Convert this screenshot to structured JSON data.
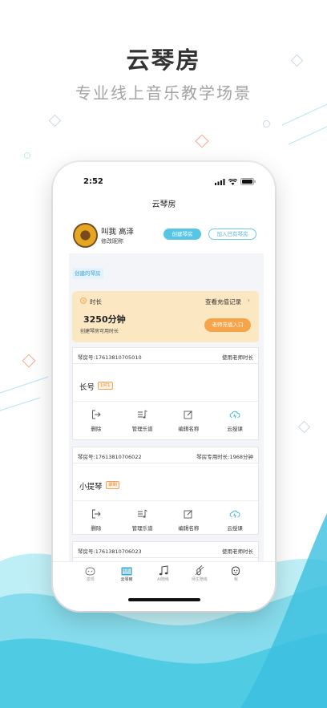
{
  "hero": {
    "title": "云琴房",
    "subtitle": "专业线上音乐教学场景"
  },
  "status_bar": {
    "time": "2:52"
  },
  "nav": {
    "title": "云琴房"
  },
  "profile": {
    "nickname": "叫我 高泽",
    "edit_label": "修改昵称",
    "create_button": "创建琴房",
    "join_button": "加入已有琴房"
  },
  "section_tag": "创建的琴房",
  "time_card": {
    "label": "时长",
    "records_link": "查看充值记录",
    "value": "3250分钟",
    "desc": "创建琴房可用时长",
    "recharge_button": "老师充值入口"
  },
  "rooms": [
    {
      "number": "琴房号:17613810705010",
      "usage": "使用老师时长",
      "name": "长号",
      "badge": "1对1",
      "actions": [
        "删除",
        "管理乐谱",
        "编辑名称",
        "云授课"
      ]
    },
    {
      "number": "琴房号:17613810706022",
      "usage": "琴房专用时长:1968分钟",
      "name": "小提琴",
      "badge": "录制",
      "actions": [
        "删除",
        "管理乐谱",
        "编辑名称",
        "云授课"
      ]
    },
    {
      "number": "琴房号:17613810706023",
      "usage": "使用老师时长"
    }
  ],
  "tabbar": [
    {
      "label": "发现",
      "icon": "discover-icon"
    },
    {
      "label": "云琴房",
      "icon": "piano-room-icon",
      "active": true
    },
    {
      "label": "AI陪练",
      "icon": "music-note-icon"
    },
    {
      "label": "师生陪练",
      "icon": "violin-icon"
    },
    {
      "label": "我",
      "icon": "profile-icon"
    }
  ],
  "colors": {
    "accent": "#56c5e6",
    "card_bg": "#fbe7c1",
    "orange": "#f6a44a",
    "wave_light": "#9fe3f0",
    "wave_dark": "#3ec7e2"
  }
}
